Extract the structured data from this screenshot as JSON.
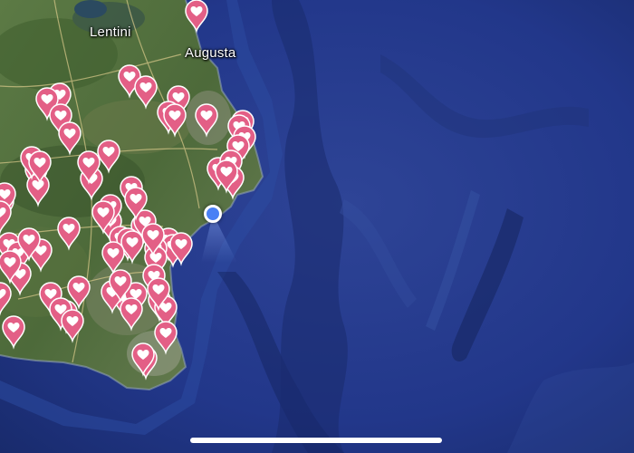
{
  "map": {
    "view": "satellite",
    "labels": [
      {
        "text": "Lentini",
        "name": "city-label-lentini"
      },
      {
        "text": "Augusta",
        "name": "city-label-augusta"
      }
    ],
    "pin_icon": "heart-pin-icon",
    "pin_color": "#e35f86",
    "pin_count": 72,
    "my_location_icon": "my-location-dot-icon",
    "my_location_color": "#4a80f5",
    "water_color": "#24398a",
    "land_color": "#4f6a3a"
  }
}
